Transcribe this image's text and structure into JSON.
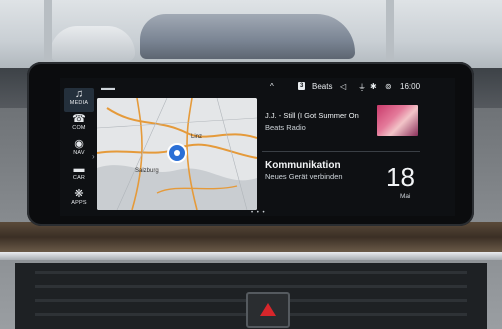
{
  "status_bar": {
    "up_arrow": "^",
    "source_badge": "3",
    "source_name": "Beats",
    "time": "16:00"
  },
  "nav_rail": [
    {
      "icon": "music-note-icon",
      "glyph": "♫",
      "label": "MEDIA",
      "active": true
    },
    {
      "icon": "phone-icon",
      "glyph": "☎",
      "label": "COM",
      "active": false
    },
    {
      "icon": "navigation-icon",
      "glyph": "◉",
      "label": "NAV",
      "active": false
    },
    {
      "icon": "car-icon",
      "glyph": "▬",
      "label": "CAR",
      "active": false
    },
    {
      "icon": "apps-icon",
      "glyph": "❋",
      "label": "APPS",
      "active": false
    }
  ],
  "map": {
    "cities": [
      "Linz",
      "Salzburg"
    ],
    "pager": "• • •"
  },
  "media_widget": {
    "track": "J.J. - Still (I Got Summer On",
    "station": "Beats Radio"
  },
  "comm_widget": {
    "title": "Kommunikation",
    "subtitle": "Neues Gerät verbinden",
    "day": "18",
    "month": "Mai"
  },
  "colors": {
    "screen_bg": "#0e1013",
    "hazard_red": "#d8262b",
    "rail_active": "#24303c"
  }
}
